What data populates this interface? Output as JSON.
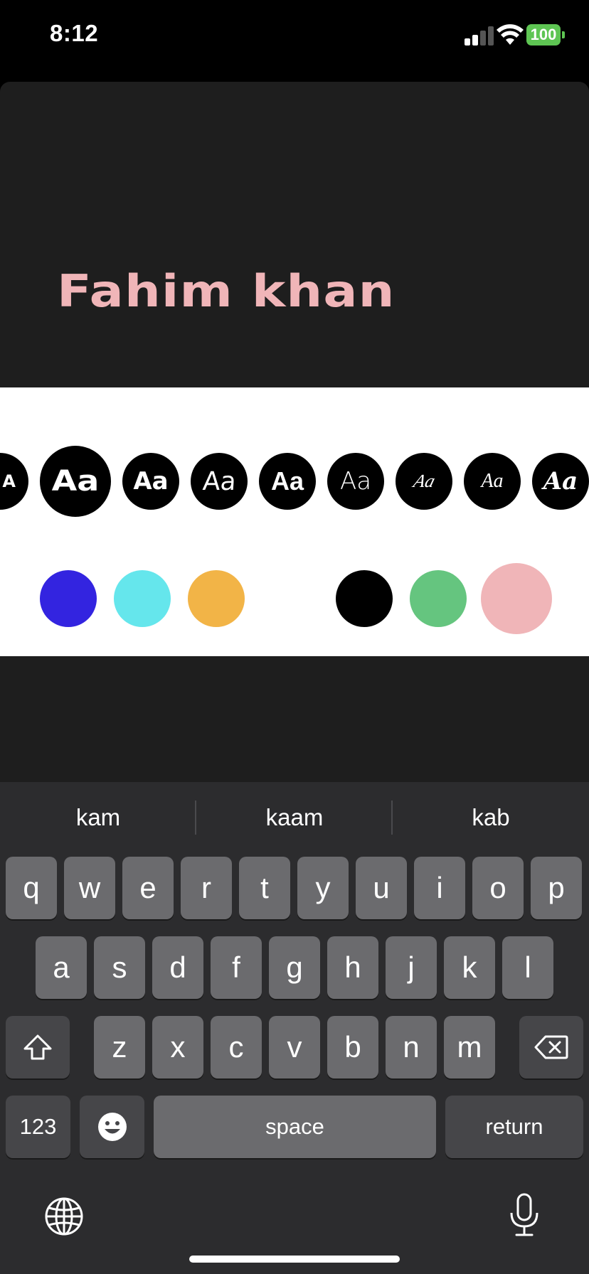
{
  "status_bar": {
    "time": "8:12",
    "battery": "100",
    "cellular_bars_filled": 2,
    "cellular_bars_total": 4
  },
  "preview": {
    "text": "Fahim khan",
    "text_color": "#f0b5b8"
  },
  "font_options": [
    {
      "label": "A",
      "font": "bold-wide"
    },
    {
      "label": "Aa",
      "font": "bold-wide",
      "selected": true
    },
    {
      "label": "Aa",
      "font": "bold-rounded"
    },
    {
      "label": "Aa",
      "font": "handwritten"
    },
    {
      "label": "Aa",
      "font": "bold-sans"
    },
    {
      "label": "Aa",
      "font": "thin-sans"
    },
    {
      "label": "Aa",
      "font": "script-thin"
    },
    {
      "label": "Aa",
      "font": "script-italic"
    },
    {
      "label": "Aa",
      "font": "script-bold"
    }
  ],
  "color_options": [
    {
      "color": "#3324e0"
    },
    {
      "color": "#65e6ec"
    },
    {
      "color": "#f2b447"
    },
    {
      "color": "#ffffff"
    },
    {
      "color": "#000000"
    },
    {
      "color": "#65c57f"
    },
    {
      "color": "#f0b5b8",
      "selected": true
    }
  ],
  "keyboard": {
    "suggestions": [
      "kam",
      "kaam",
      "kab"
    ],
    "row1": [
      "q",
      "w",
      "e",
      "r",
      "t",
      "y",
      "u",
      "i",
      "o",
      "p"
    ],
    "row2": [
      "a",
      "s",
      "d",
      "f",
      "g",
      "h",
      "j",
      "k",
      "l"
    ],
    "row3": [
      "z",
      "x",
      "c",
      "v",
      "b",
      "n",
      "m"
    ],
    "numbers_label": "123",
    "space_label": "space",
    "return_label": "return",
    "icons": [
      "shift-icon",
      "delete-icon",
      "emoji-icon",
      "globe-icon",
      "microphone-icon"
    ]
  }
}
